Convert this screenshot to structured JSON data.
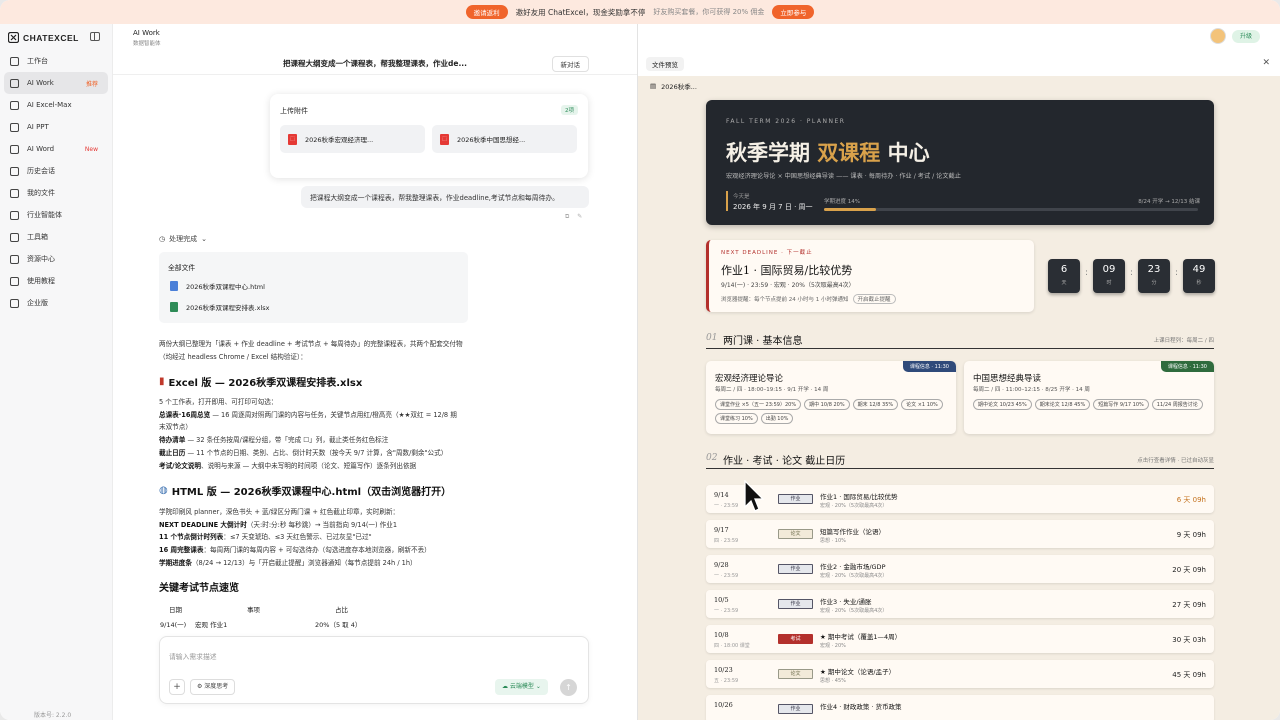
{
  "banner": {
    "pill": "邀请返利",
    "main": "邀好友用 ChatExcel，现金奖励拿不停",
    "sub": "好友购买套餐，你可获得 20% 佣金",
    "cta": "立即参与"
  },
  "sidebar": {
    "brand": "CHATEXCEL",
    "items": [
      {
        "label": "工作台",
        "badge": ""
      },
      {
        "label": "AI Work",
        "badge": "推荐"
      },
      {
        "label": "AI Excel-Max",
        "badge": ""
      },
      {
        "label": "AI PPT",
        "badge": ""
      },
      {
        "label": "AI Word",
        "badge": "New"
      },
      {
        "label": "历史会话",
        "badge": ""
      },
      {
        "label": "我的文件",
        "badge": ""
      },
      {
        "label": "行业智能体",
        "badge": ""
      },
      {
        "label": "工具箱",
        "badge": ""
      },
      {
        "label": "资源中心",
        "badge": ""
      },
      {
        "label": "使用教程",
        "badge": ""
      },
      {
        "label": "企业版",
        "badge": ""
      }
    ],
    "version": "版本号: 2.2.0"
  },
  "chat": {
    "title": "AI Work",
    "subtitle": "数据智能体",
    "subject": "把课程大纲变成一个课程表，帮我整理课表，作业de...",
    "new_chat": "新对话",
    "attach": {
      "title": "上传附件",
      "count": "2项",
      "files": [
        "2026秋季宏观经济理...",
        "2026秋季中国思想经..."
      ]
    },
    "user_msg": "把课程大纲变成一个课程表，帮我整理课表，作业deadline,考试节点和每周待办。",
    "status": "处理完成",
    "files_box": {
      "title": "全部文件",
      "files": [
        "2026秋季双课程中心.html",
        "2026秋季双课程安排表.xlsx"
      ]
    },
    "intro": "两份大纲已整理为「课表 + 作业 deadline + 考试节点 + 每周待办」的完整课程表，共两个配套交付物",
    "intro2": "（均经过 headless Chrome / Excel 结构验证）：",
    "excel_h": "Excel 版 — 2026秋季双课程安排表.xlsx",
    "excel_lines": [
      {
        "b": "",
        "t": "5 个工作表，打开即用、可打印可勾选："
      },
      {
        "b": "总课表·16周总览",
        "t": " — 16 周逐周对照两门课的内容与任务，关键节点用红/橙高亮（★★双红 = 12/8 期"
      },
      {
        "b": "",
        "t": "末双节点）"
      },
      {
        "b": "待办清单",
        "t": " — 32 条任务按周/课程分组，带「完成 ☐」列，截止类任务红色标注"
      },
      {
        "b": "截止日历",
        "t": " — 11 个节点的日期、类别、占比、倒计时天数（按今天 9/7 计算，含\"周数/剩余\"公式）"
      },
      {
        "b": "考试/论文说明",
        "t": "、说明与来源 — 大纲中未写明的时间项（论文、短篇写作）逐条列出依据"
      }
    ],
    "html_h": "HTML 版 — 2026秋季双课程中心.html（双击浏览器打开）",
    "html_lines": [
      {
        "b": "",
        "t": "学院印刷风 planner，深色书头 + 蓝/绿区分两门课 + 红色截止印章，实时刷新："
      },
      {
        "b": "NEXT DEADLINE 大倒计时",
        "t": "（天:时:分:秒 每秒跳）→ 当前指向 9/14(一) 作业1"
      },
      {
        "b": "11 个节点倒计时列表",
        "t": "：≤7 天变琥珀、≤3 天红色警示、已过灰显\"已过\""
      },
      {
        "b": "16 周完整课表",
        "t": "：每周两门课的每周内容 + 可勾选待办（勾选进度存本地浏览器，刷新不丢）"
      },
      {
        "b": "学期进度条",
        "t": "（8/24 → 12/13）与「开启截止提醒」浏览器通知（每节点提前 24h / 1h）"
      }
    ],
    "key_h": "关键考试节点速览",
    "table": {
      "headers": [
        "日期",
        "事项",
        "占比"
      ],
      "row": [
        "9/14(一)",
        "宏观 作业1",
        "20%（5 取 4）"
      ]
    },
    "composer": {
      "placeholder": "请输入需求描述",
      "plus": "+",
      "deep": "深度思考",
      "model": "云端模型"
    }
  },
  "preview": {
    "tab": "文件预览",
    "file": "2026秋季...",
    "hero": {
      "eyebrow": "FALL TERM 2026 · PLANNER",
      "title_a": "秋季学期 ",
      "title_b": "双课程",
      "title_c": " 中心",
      "desc": "宏观经济理论导论 × 中国思想经典导读 —— 课表 · 每周待办 · 作业 / 考试 / 论文截止",
      "today_label": "今天是",
      "today": "2026 年 9 月 7 日 · 周一",
      "progress_label": "学期进度 14%",
      "progress_right": "8/24 开学 → 12/13 结课",
      "progress": 0.14
    },
    "next": {
      "eyebrow": "NEXT DEADLINE · 下一截止",
      "name": "作业1 · 国际贸易/比较优势",
      "meta": "9/14(一) · 23:59 · 宏观 · 20%（5次取最高4次）",
      "note": "浏览器提醒：每个节点提前 24 小时与 1 小时弹通知",
      "btn": "开启截止提醒"
    },
    "countdown": [
      {
        "n": "6",
        "u": "天"
      },
      {
        "n": "09",
        "u": "时"
      },
      {
        "n": "23",
        "u": "分"
      },
      {
        "n": "49",
        "u": "秒"
      }
    ],
    "sec1": {
      "num": "01",
      "txt": "两门课 · 基本信息",
      "right": "上课日程列：每周二 / 四"
    },
    "courses": [
      {
        "name": "宏观经济理论导论",
        "sched": "每周二 / 四 · 18:00–19:15 · 9/1 开学 · 14 周",
        "tag": "课程信息 · 11:30",
        "color": "#2f4a7a",
        "chips": [
          "课堂作业 ×5（五一 23:59）20%",
          "期中 10/8 20%",
          "期末 12/8 35%",
          "论文 ×1 10%",
          "课堂练习 10%",
          "出勤 10%"
        ]
      },
      {
        "name": "中国思想经典导读",
        "sched": "每周二 / 四 · 11:00–12:15 · 8/25 开学 · 14 周",
        "tag": "课程信息 · 11:30",
        "color": "#2f6b3d",
        "chips": [
          "期中论文 10/23 45%",
          "期末论文 12/8 45%",
          "短篇写作 9/17 10%",
          "11/24 周报告讨论"
        ]
      }
    ],
    "sec2": {
      "num": "02",
      "txt": "作业 · 考试 · 论文 截止日历",
      "right": "点击行查看详情 · 已过自动灰显"
    },
    "items": [
      {
        "d": "9/14",
        "wd": "一 · 23:59",
        "type": "作业",
        "kind": "hw",
        "t": "作业1 · 国际贸易/比较优势",
        "sub": "宏观 · 20%（5次取最高4次）",
        "left": "6 天 09h",
        "soon": true
      },
      {
        "d": "9/17",
        "wd": "四 · 23:59",
        "type": "论文",
        "kind": "paper",
        "t": "短篇写作作业（论语）",
        "sub": "思想 · 10%",
        "left": "9 天 09h",
        "soon": false
      },
      {
        "d": "9/28",
        "wd": "一 · 23:59",
        "type": "作业",
        "kind": "hw",
        "t": "作业2 · 金融市场/GDP",
        "sub": "宏观 · 20%（5次取最高4次）",
        "left": "20 天 09h",
        "soon": false
      },
      {
        "d": "10/5",
        "wd": "一 · 23:59",
        "type": "作业",
        "kind": "hw",
        "t": "作业3 · 失业/通胀",
        "sub": "宏观 · 20%（5次取最高4次）",
        "left": "27 天 09h",
        "soon": false
      },
      {
        "d": "10/8",
        "wd": "四 · 18:00 课堂",
        "type": "考试",
        "kind": "exam",
        "t": "★ 期中考试（覆盖1—4周）",
        "sub": "宏观 · 20%",
        "left": "30 天 03h",
        "soon": false
      },
      {
        "d": "10/23",
        "wd": "五 · 23:59",
        "type": "论文",
        "kind": "paper",
        "t": "★ 期中论文（论语/孟子）",
        "sub": "思想 · 45%",
        "left": "45 天 09h",
        "soon": false
      },
      {
        "d": "10/26",
        "wd": "",
        "type": "作业",
        "kind": "hw",
        "t": "作业4 · 财政政策 · 货币政策",
        "sub": "",
        "left": "",
        "soon": false
      }
    ]
  }
}
